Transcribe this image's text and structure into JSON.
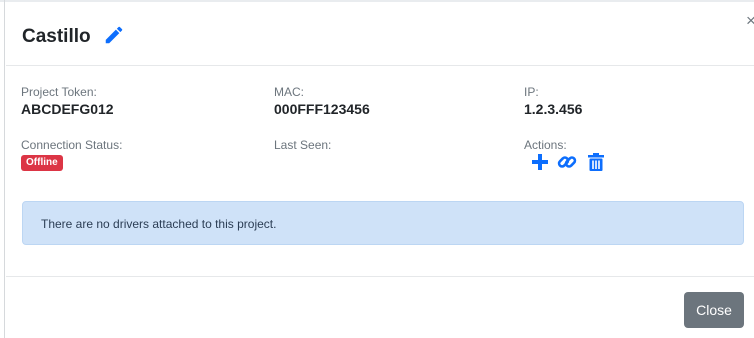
{
  "modal": {
    "title": "Castillo",
    "close_glyph": "×"
  },
  "fields": {
    "project_token": {
      "label": "Project Token:",
      "value": "ABCDEFG012"
    },
    "mac": {
      "label": "MAC:",
      "value": "000FFF123456"
    },
    "ip": {
      "label": "IP:",
      "value": "1.2.3.456"
    },
    "connection_status": {
      "label": "Connection Status:",
      "badge": "Offline"
    },
    "last_seen": {
      "label": "Last Seen:",
      "value": ""
    },
    "actions": {
      "label": "Actions:",
      "icons": [
        "plus-icon",
        "link-icon",
        "trash-icon"
      ]
    }
  },
  "alert": {
    "message": "There are no drivers attached to this project."
  },
  "footer": {
    "close_label": "Close"
  },
  "colors": {
    "accent": "#0d6efd",
    "danger": "#dc3545",
    "alert_bg": "#cfe2f8",
    "secondary_button": "#6c757d"
  }
}
